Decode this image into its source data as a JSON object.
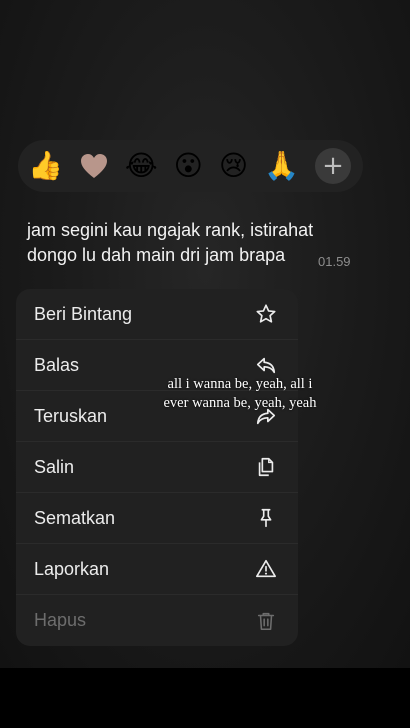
{
  "reactions": [
    {
      "name": "thumbs-up",
      "glyph": "👍"
    },
    {
      "name": "heart",
      "glyph": "🤎"
    },
    {
      "name": "tears-of-joy",
      "glyph": "😂"
    },
    {
      "name": "surprised",
      "glyph": "😮"
    },
    {
      "name": "crying",
      "glyph": "😢"
    },
    {
      "name": "praying-hands",
      "glyph": "🙏"
    }
  ],
  "reaction_more": "+",
  "message": {
    "text": "jam segini kau ngajak rank, istirahat dongo lu dah main dri jam brapa",
    "time": "01.59"
  },
  "menu": {
    "items": [
      {
        "label": "Beri Bintang",
        "icon": "star-icon"
      },
      {
        "label": "Balas",
        "icon": "reply-icon"
      },
      {
        "label": "Teruskan",
        "icon": "forward-icon"
      },
      {
        "label": "Salin",
        "icon": "copy-icon"
      },
      {
        "label": "Sematkan",
        "icon": "pin-icon"
      },
      {
        "label": "Laporkan",
        "icon": "warning-icon"
      },
      {
        "label": "Hapus",
        "icon": "trash-icon",
        "muted": true
      }
    ]
  },
  "overlay": {
    "line1": "all i wanna be, yeah, all i",
    "line2": "ever wanna be, yeah, yeah"
  },
  "colors": {
    "background": "#1c1c1c",
    "menu": "#212121",
    "text": "#f2f2f2",
    "muted": "#6d6d6d"
  }
}
